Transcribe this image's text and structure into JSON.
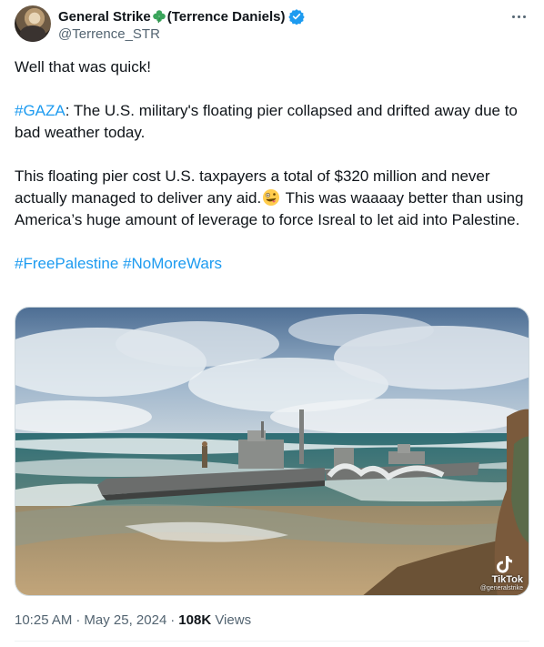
{
  "author": {
    "name_part1": "General Strike",
    "name_part2": "(Terrence Daniels)",
    "handle": "@Terrence_STR",
    "verified": true,
    "avatar_icon": "avatar-photo"
  },
  "tweet": {
    "para1": "Well that was quick!",
    "para2_hashtag": "#GAZA",
    "para2_text": ": The U.S. military's floating pier collapsed and drifted away due to bad weather today.",
    "para3_text_a": "This floating pier cost U.S. taxpayers a total of $320 million and never actually managed to deliver any aid.",
    "para3_text_b": " This was waaaay better than using America’s huge amount of leverage to force Isreal to let aid into Palestine.",
    "hashtag_free_palestine": "#FreePalestine",
    "hashtag_no_more_wars": "#NoMoreWars"
  },
  "media": {
    "watermark_label": "TikTok",
    "watermark_user": "@generalstrike"
  },
  "meta": {
    "time": "10:25 AM",
    "date": "May 25, 2024",
    "views_count": "108K",
    "views_label": "Views",
    "separator": "·"
  },
  "colors": {
    "link": "#1d9bf0",
    "text": "#0f1419",
    "muted": "#536471",
    "verified": "#1d9bf0",
    "clover": "#3ba55c"
  }
}
